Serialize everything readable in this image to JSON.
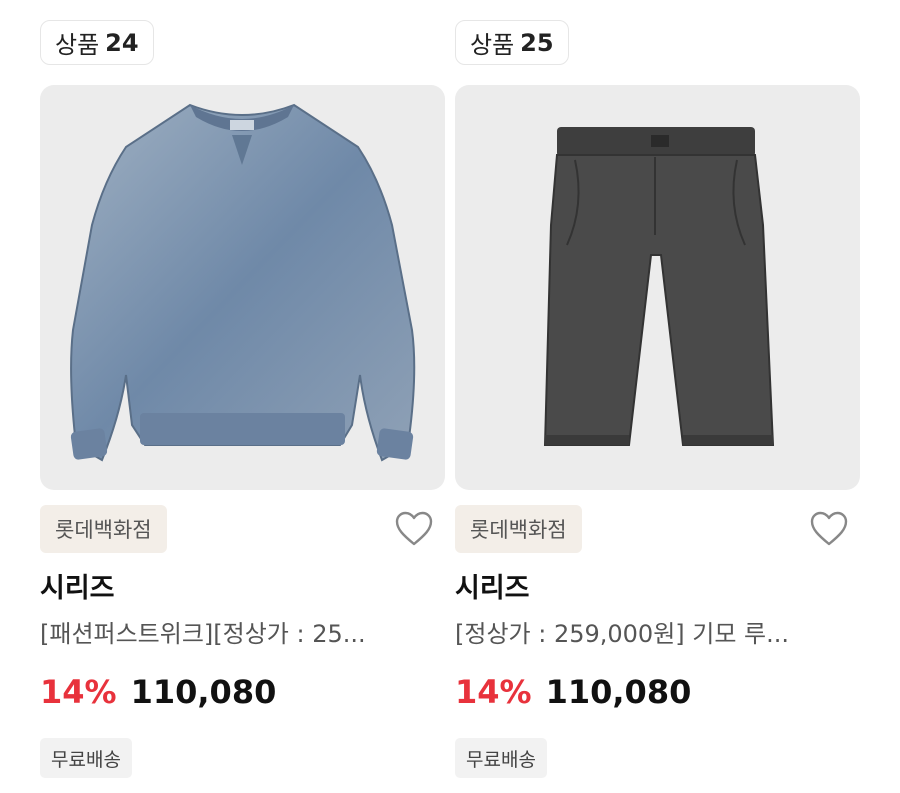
{
  "products": [
    {
      "label_prefix": "상품",
      "label_number": "24",
      "image_icon": "sweatshirt-image",
      "store": "롯데백화점",
      "brand": "시리즈",
      "description": "[패션퍼스트위크][정상가 : 25...",
      "discount": "14%",
      "price": "110,080",
      "shipping": "무료배송"
    },
    {
      "label_prefix": "상품",
      "label_number": "25",
      "image_icon": "pants-image",
      "store": "롯데백화점",
      "brand": "시리즈",
      "description": "[정상가 : 259,000원] 기모 루...",
      "discount": "14%",
      "price": "110,080",
      "shipping": "무료배송"
    }
  ],
  "colors": {
    "discount": "#e8323c",
    "store_badge_bg": "#f3eee8",
    "shipping_bg": "#f2f2f2",
    "image_bg": "#ececec"
  }
}
